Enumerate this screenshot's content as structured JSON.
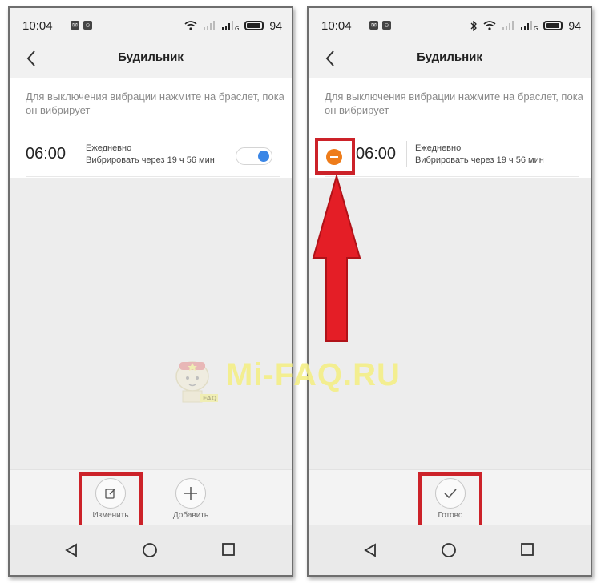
{
  "status_bar": {
    "time": "10:04",
    "battery": "94",
    "network": "G"
  },
  "screen": {
    "title": "Будильник",
    "hint": "Для выключения вибрации нажмите на браслет, пока он вибрирует"
  },
  "alarm": {
    "time": "06:00",
    "repeat": "Ежедневно",
    "countdown": "Вибрировать через 19 ч 56 мин",
    "enabled": true
  },
  "actions_left": {
    "edit_label": "Изменить",
    "add_label": "Добавить"
  },
  "actions_right": {
    "done_label": "Готово"
  },
  "watermark": {
    "text": "Mi-FAQ.RU",
    "badge": "FAQ"
  },
  "colors": {
    "highlight": "#cc2229",
    "toggle_on": "#3a86e6",
    "delete_icon": "#ee7c1a",
    "watermark": "#f4ef86"
  },
  "icons": {
    "back": "chevron-left-icon",
    "edit": "edit-icon",
    "add": "plus-icon",
    "done": "check-icon",
    "nav_back": "triangle-back-icon",
    "nav_home": "circle-home-icon",
    "nav_recent": "square-recent-icon",
    "delete": "minus-circle-icon"
  }
}
